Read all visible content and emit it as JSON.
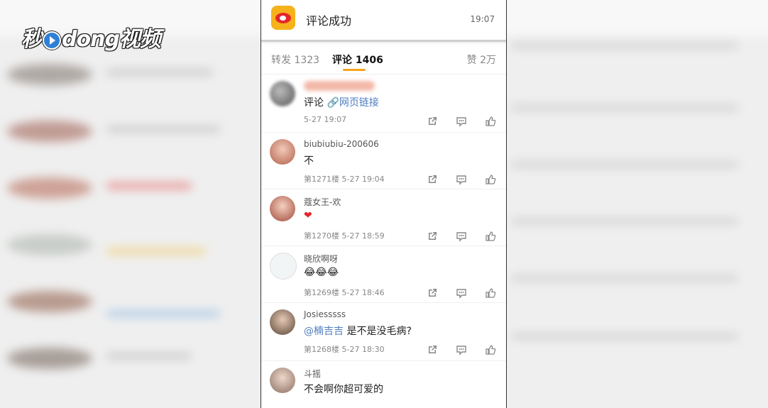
{
  "watermark": {
    "text_left": "秒",
    "text_mid": "dong",
    "text_right": "视频"
  },
  "notification": {
    "title": "评论成功",
    "time": "19:07"
  },
  "tabs": [
    {
      "label": "转发 1323",
      "active": false
    },
    {
      "label": "评论 1406",
      "active": true
    },
    {
      "label": "赞 2万",
      "active": false
    }
  ],
  "comments": [
    {
      "author": "",
      "text": "评论",
      "link": "网页链接",
      "meta": "5-27 19:07"
    },
    {
      "author": "biubiubiu-200606",
      "text": "不",
      "meta": "第1271楼  5-27 19:04"
    },
    {
      "author": "蔻女王-欢",
      "text": "❤",
      "meta": "第1270楼  5-27 18:59"
    },
    {
      "author": "晓欣啊呀",
      "text": "😂😂😂",
      "meta": "第1269楼  5-27 18:46"
    },
    {
      "author": "Josiesssss",
      "mention": "@楠吉吉",
      "text": "是不是没毛病?",
      "meta": "第1268楼  5-27 18:30"
    },
    {
      "author": "斗摇",
      "text": "不会啊你超可爱的",
      "meta": ""
    }
  ],
  "colors": {
    "accent": "#f7a21b",
    "link": "#4f7dbf",
    "weibo_red": "#e4262c"
  }
}
